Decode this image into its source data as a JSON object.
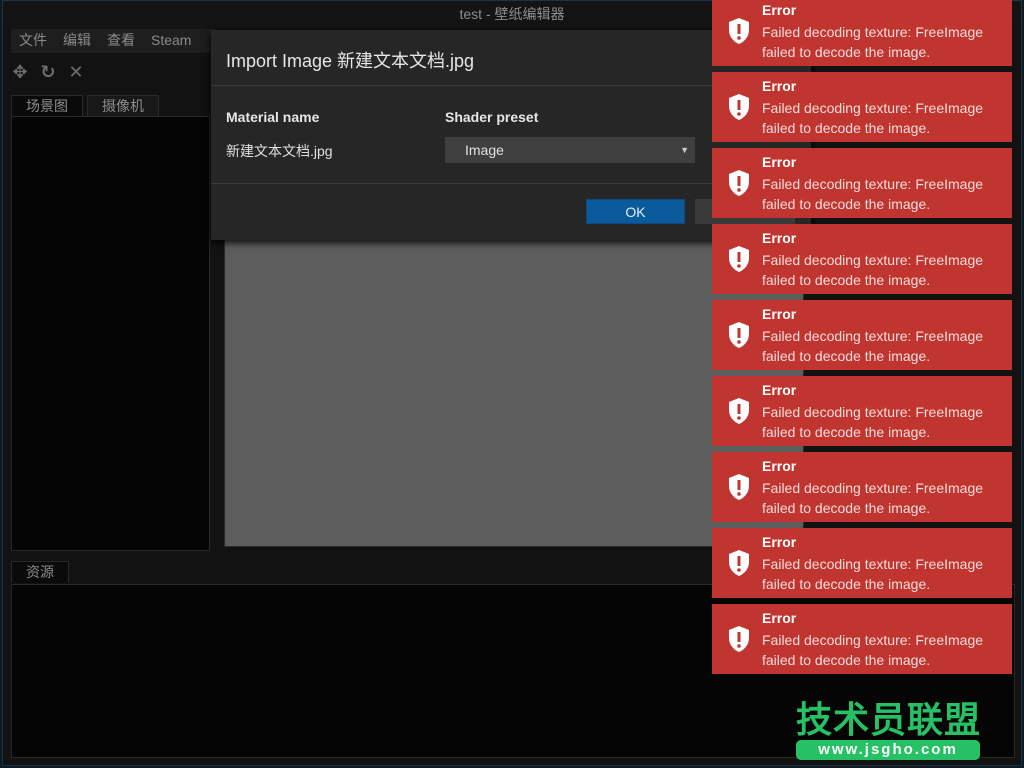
{
  "window": {
    "title": "test - 壁纸编辑器"
  },
  "menu": [
    "文件",
    "编辑",
    "查看",
    "Steam"
  ],
  "toolbar": {
    "icons": [
      "move-icon",
      "rotate-icon",
      "scale-icon"
    ],
    "glyphs": [
      "✥",
      "↻",
      "✕"
    ]
  },
  "left_tabs": [
    "场景图",
    "摄像机"
  ],
  "bottom_tab": "资源",
  "dialog": {
    "title": "Import Image 新建文本文档.jpg",
    "material_label": "Material name",
    "material_value": "新建文本文档.jpg",
    "shader_label": "Shader preset",
    "shader_value": "Image",
    "ok": "OK"
  },
  "toasts": [
    {
      "title": "Error",
      "message": "Failed decoding texture: FreeImage failed to decode the image."
    },
    {
      "title": "Error",
      "message": "Failed decoding texture: FreeImage failed to decode the image."
    },
    {
      "title": "Error",
      "message": "Failed decoding texture: FreeImage failed to decode the image."
    },
    {
      "title": "Error",
      "message": "Failed decoding texture: FreeImage failed to decode the image."
    },
    {
      "title": "Error",
      "message": "Failed decoding texture: FreeImage failed to decode the image."
    },
    {
      "title": "Error",
      "message": "Failed decoding texture: FreeImage failed to decode the image."
    },
    {
      "title": "Error",
      "message": "Failed decoding texture: FreeImage failed to decode the image."
    },
    {
      "title": "Error",
      "message": "Failed decoding texture: FreeImage failed to decode the image."
    },
    {
      "title": "Error",
      "message": "Failed decoding texture: FreeImage failed to decode the image."
    }
  ],
  "watermark": {
    "text": "技术员联盟",
    "url": "www.jsgho.com"
  },
  "colors": {
    "error": "#c0352f",
    "accent": "#0a5a9c",
    "watermark": "#27c165"
  }
}
